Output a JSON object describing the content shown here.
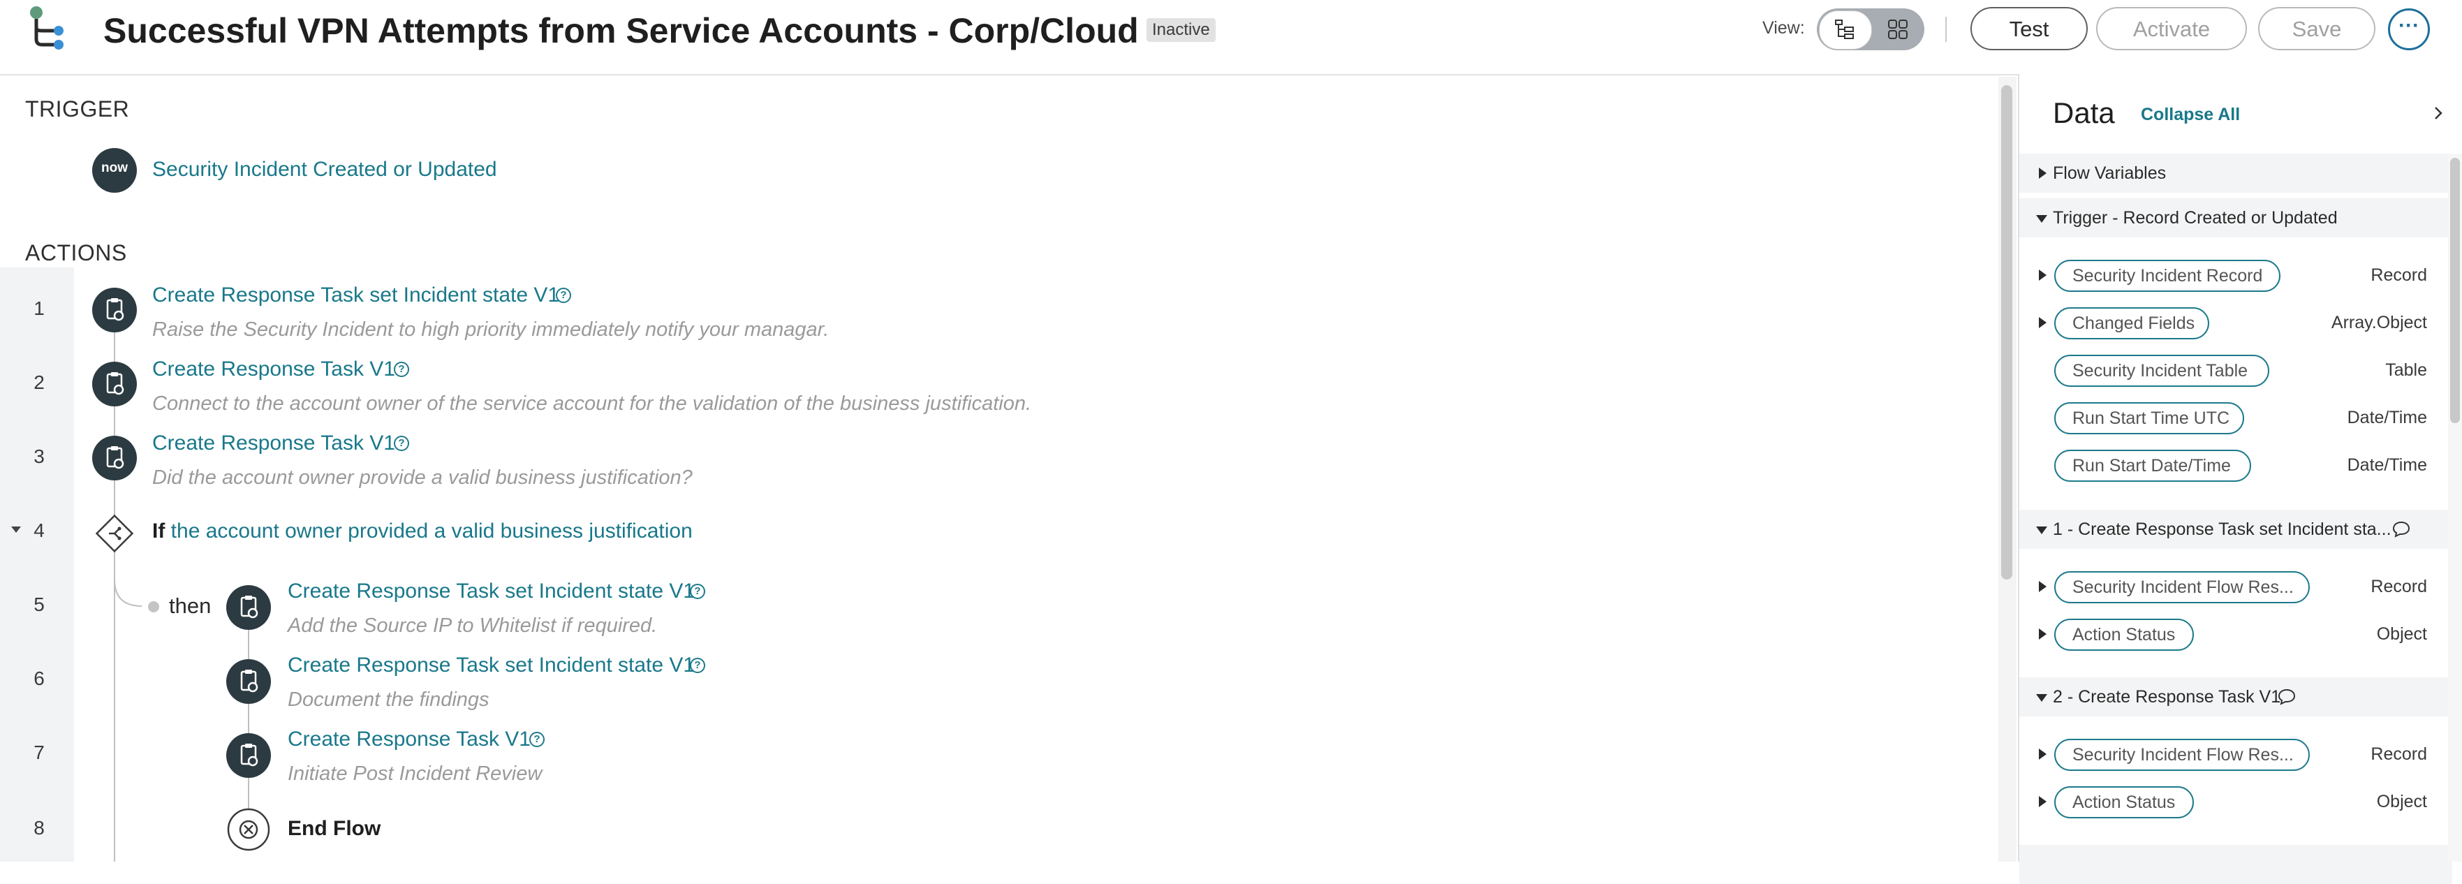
{
  "header": {
    "title": "Successful VPN Attempts from Service Accounts - Corp/Cloud",
    "status": "Inactive",
    "view_label": "View:",
    "buttons": {
      "test": "Test",
      "activate": "Activate",
      "save": "Save",
      "more": "···"
    }
  },
  "canvas": {
    "trigger_heading": "TRIGGER",
    "trigger": {
      "icon_text": "now",
      "label": "Security Incident Created or Updated"
    },
    "actions_heading": "ACTIONS",
    "actions": [
      {
        "num": "1",
        "label": "Create Response Task set Incident state V1",
        "desc": "Raise the Security Incident to high priority immediately notify your managar."
      },
      {
        "num": "2",
        "label": "Create Response Task V1",
        "desc": "Connect to the account owner of the service account for the validation of the business justification."
      },
      {
        "num": "3",
        "label": "Create Response Task V1",
        "desc": "Did the account owner provide a valid business justification?"
      }
    ],
    "if_step": {
      "num": "4",
      "keyword": "If",
      "condition": "the account owner provided a valid business justification"
    },
    "then_label": "then",
    "then_actions": [
      {
        "num": "5",
        "label": "Create Response Task set Incident state V1",
        "desc": "Add the Source IP to Whitelist if required."
      },
      {
        "num": "6",
        "label": "Create Response Task set Incident state V1",
        "desc": "Document the findings"
      },
      {
        "num": "7",
        "label": "Create Response Task V1",
        "desc": "Initiate Post Incident Review"
      }
    ],
    "end_step": {
      "num": "8",
      "label": "End Flow"
    }
  },
  "panel": {
    "title": "Data",
    "collapse_all": "Collapse All",
    "flow_variables": "Flow Variables",
    "trigger_section": {
      "title": "Trigger - Record Created or Updated",
      "pills": [
        {
          "label": "Security Incident Record",
          "type": "Record"
        },
        {
          "label": "Changed Fields",
          "type": "Array.Object"
        },
        {
          "label": "Security Incident Table",
          "type": "Table"
        },
        {
          "label": "Run Start Time UTC",
          "type": "Date/Time"
        },
        {
          "label": "Run Start Date/Time",
          "type": "Date/Time"
        }
      ]
    },
    "step1_section": {
      "title": "1 - Create Response Task set Incident sta...",
      "pills": [
        {
          "label": "Security Incident Flow Res...",
          "type": "Record"
        },
        {
          "label": "Action Status",
          "type": "Object"
        }
      ]
    },
    "step2_section": {
      "title": "2 - Create Response Task V1",
      "pills": [
        {
          "label": "Security Incident Flow Res...",
          "type": "Record"
        },
        {
          "label": "Action Status",
          "type": "Object"
        }
      ]
    }
  },
  "colors": {
    "accent": "#19788a",
    "node_dark": "#2c3b41",
    "button_blue": "#1d6f9b"
  }
}
